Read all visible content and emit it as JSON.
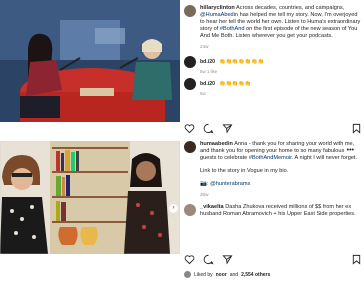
{
  "post1": {
    "username": "hillaryclinton",
    "caption_text": " Across decades, countries, and campaigns, ",
    "mention": "@HumaAbedin",
    "caption_text2": " has helped me tell my story. Now, I'm overjoyed to hear her tell the world her own. Listen to Huma's extraordinary story of ",
    "hashtag": "#BothAnd",
    "caption_text3": " on the first episode of the new season of You And Me Both. Listen wherever you get your podcasts.",
    "age": "24w",
    "comments": [
      {
        "user": "bd.i20",
        "text": "👏👏👏👏👏👏👏",
        "meta": "5w  1 like"
      },
      {
        "user": "bd.i20",
        "text": "👏👏👏👏👏",
        "meta": "5w"
      }
    ]
  },
  "post2": {
    "username": "humaabedin",
    "caption_text": " Anna - thank you for sharing your world with me, and thank you for opening your home to so many fabulous guests to celebrate ",
    "hashtag": "#BothAndMemoir",
    "caption_text2": ". A night I will never forget.",
    "caption_line2": "Link to the story in Vogue in my bio.",
    "photo_credit": "📷: ",
    "photo_credit_mention": "@hunterabrams",
    "age": "26w",
    "comment_user": "_vikaelta",
    "comment_text": " Dasha Zhukova received millions of $$ from her ex husband Roman Abramovich + his Upper East Side properties.",
    "likes_text": "Liked by ",
    "likes_user": "noor",
    "likes_and": " and ",
    "likes_count": "2,554 others"
  },
  "colors": {
    "link": "#00376b",
    "muted": "#8e8e8e"
  }
}
